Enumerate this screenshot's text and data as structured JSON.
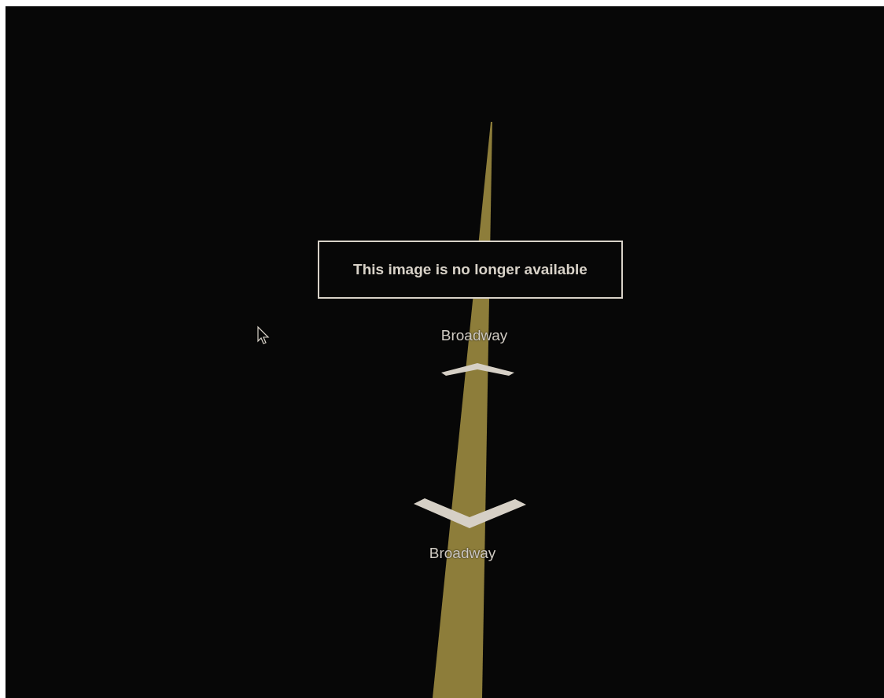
{
  "message": "This image is no longer available",
  "street_labels": [
    {
      "text": "Broadway"
    },
    {
      "text": "Broadway"
    }
  ]
}
